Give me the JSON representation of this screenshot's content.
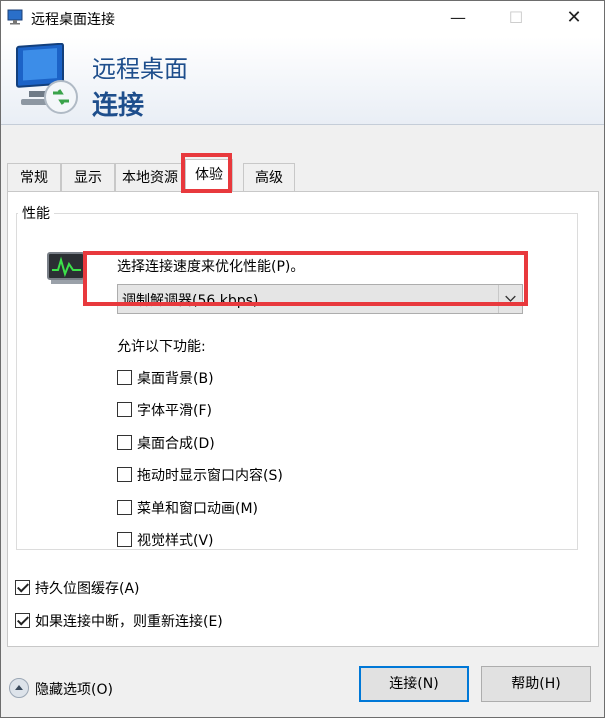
{
  "window": {
    "title": "远程桌面连接",
    "min_glyph": "—",
    "max_glyph": "☐",
    "close_glyph": "✕"
  },
  "banner": {
    "line1": "远程桌面",
    "line2": "连接"
  },
  "tabs": [
    {
      "label": "常规",
      "selected": false
    },
    {
      "label": "显示",
      "selected": false
    },
    {
      "label": "本地资源",
      "selected": false
    },
    {
      "label": "体验",
      "selected": true
    },
    {
      "label": "高级",
      "selected": false
    }
  ],
  "performance": {
    "group_title": "性能",
    "speed_label": "选择连接速度来优化性能(P)。",
    "speed_value": "调制解调器(56 kbps)",
    "allow_label": "允许以下功能:",
    "features": [
      {
        "label": "桌面背景(B)",
        "checked": false
      },
      {
        "label": "字体平滑(F)",
        "checked": false
      },
      {
        "label": "桌面合成(D)",
        "checked": false
      },
      {
        "label": "拖动时显示窗口内容(S)",
        "checked": false
      },
      {
        "label": "菜单和窗口动画(M)",
        "checked": false
      },
      {
        "label": "视觉样式(V)",
        "checked": false
      }
    ]
  },
  "options": [
    {
      "label": "持久位图缓存(A)",
      "checked": true
    },
    {
      "label": "如果连接中断，则重新连接(E)",
      "checked": true
    }
  ],
  "footer": {
    "hide_options": "隐藏选项(O)",
    "connect": "连接(N)",
    "help": "帮助(H)"
  },
  "colors": {
    "highlight": "#e8393d",
    "accent": "#0078d7",
    "banner_text": "#1e4e8c"
  }
}
